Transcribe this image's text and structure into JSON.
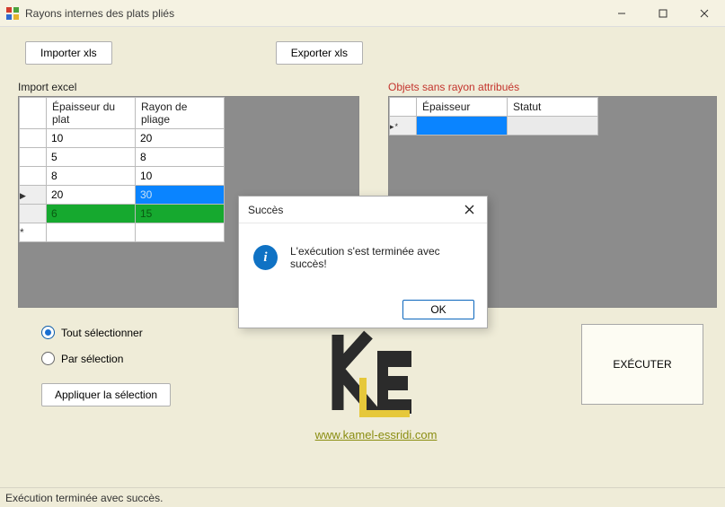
{
  "window": {
    "title": "Rayons internes des plats pliés"
  },
  "toolbar": {
    "import_label": "Importer xls",
    "export_label": "Exporter xls"
  },
  "left_panel": {
    "label": "Import excel",
    "col_epaisseur": "Épaisseur du plat",
    "col_rayon": "Rayon de pliage",
    "rows": [
      {
        "ep": "10",
        "ra": "20"
      },
      {
        "ep": "5",
        "ra": "8"
      },
      {
        "ep": "8",
        "ra": "10"
      },
      {
        "ep": "20",
        "ra": "30"
      },
      {
        "ep": "6",
        "ra": "15"
      }
    ]
  },
  "right_panel": {
    "label": "Objets sans rayon attribués",
    "col_epaisseur": "Épaisseur",
    "col_statut": "Statut"
  },
  "options": {
    "opt_all": "Tout sélectionner",
    "opt_sel": "Par sélection",
    "apply_label": "Appliquer la sélection"
  },
  "footer": {
    "url": "www.kamel-essridi.com",
    "status": "Exécution terminée avec succès."
  },
  "execute": {
    "label": "EXÉCUTER"
  },
  "dialog": {
    "title": "Succès",
    "message": "L'exécution s'est terminée avec succès!",
    "ok": "OK"
  }
}
